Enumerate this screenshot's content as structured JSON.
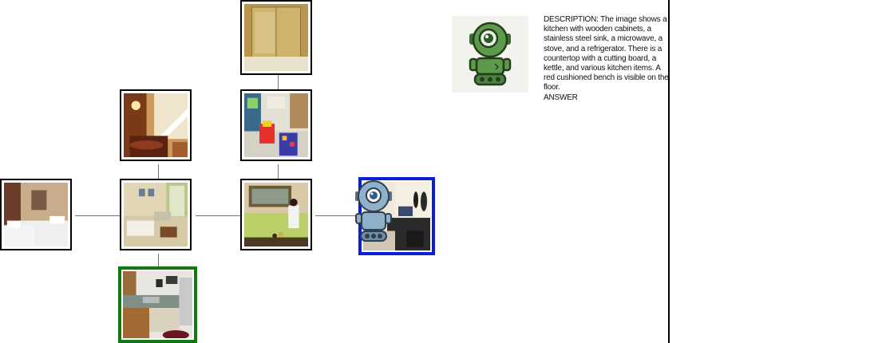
{
  "colors": {
    "goal_border": "#0f7a0f",
    "current_border": "#0a1fd6",
    "node_border": "#000000",
    "edge": "#777777",
    "robot_green": "#5e9a4c",
    "robot_blue": "#8fb0c9"
  },
  "graph": {
    "nodes": [
      {
        "id": "bedroom",
        "scene": "bedroom with two white beds",
        "icon": "bedroom-thumbnail"
      },
      {
        "id": "living-room",
        "scene": "living room with sofa and window",
        "icon": "living-room-thumbnail"
      },
      {
        "id": "dining-room",
        "scene": "dining room with staircase and chandelier",
        "icon": "dining-room-thumbnail"
      },
      {
        "id": "kitchen",
        "scene": "kitchen with wooden cabinets and sink",
        "icon": "kitchen-thumbnail",
        "role": "goal"
      },
      {
        "id": "bathroom-pool",
        "scene": "room with green floor and a person sitting",
        "icon": "green-room-thumbnail"
      },
      {
        "id": "playroom",
        "scene": "playroom with red toy car and rug",
        "icon": "playroom-thumbnail"
      },
      {
        "id": "shower",
        "scene": "glass shower enclosure",
        "icon": "shower-thumbnail"
      },
      {
        "id": "music-room",
        "scene": "music studio with guitars and computer",
        "icon": "music-room-thumbnail",
        "role": "current"
      }
    ],
    "edges": [
      [
        "bedroom",
        "living-room"
      ],
      [
        "living-room",
        "dining-room"
      ],
      [
        "living-room",
        "kitchen"
      ],
      [
        "living-room",
        "bathroom-pool"
      ],
      [
        "bathroom-pool",
        "playroom"
      ],
      [
        "playroom",
        "shower"
      ],
      [
        "bathroom-pool",
        "music-room"
      ]
    ]
  },
  "agent": {
    "icon": "robot-icon",
    "location": "music-room"
  },
  "panel": {
    "icon": "robot-icon",
    "description": "DESCRIPTION: The image shows a kitchen with wooden cabinets, a stainless steel sink, a microwave, a stove, and a refrigerator. There is a countertop with a cutting board, a kettle, and various kitchen items. A red cushioned bench is visible on the floor.\nANSWER"
  }
}
